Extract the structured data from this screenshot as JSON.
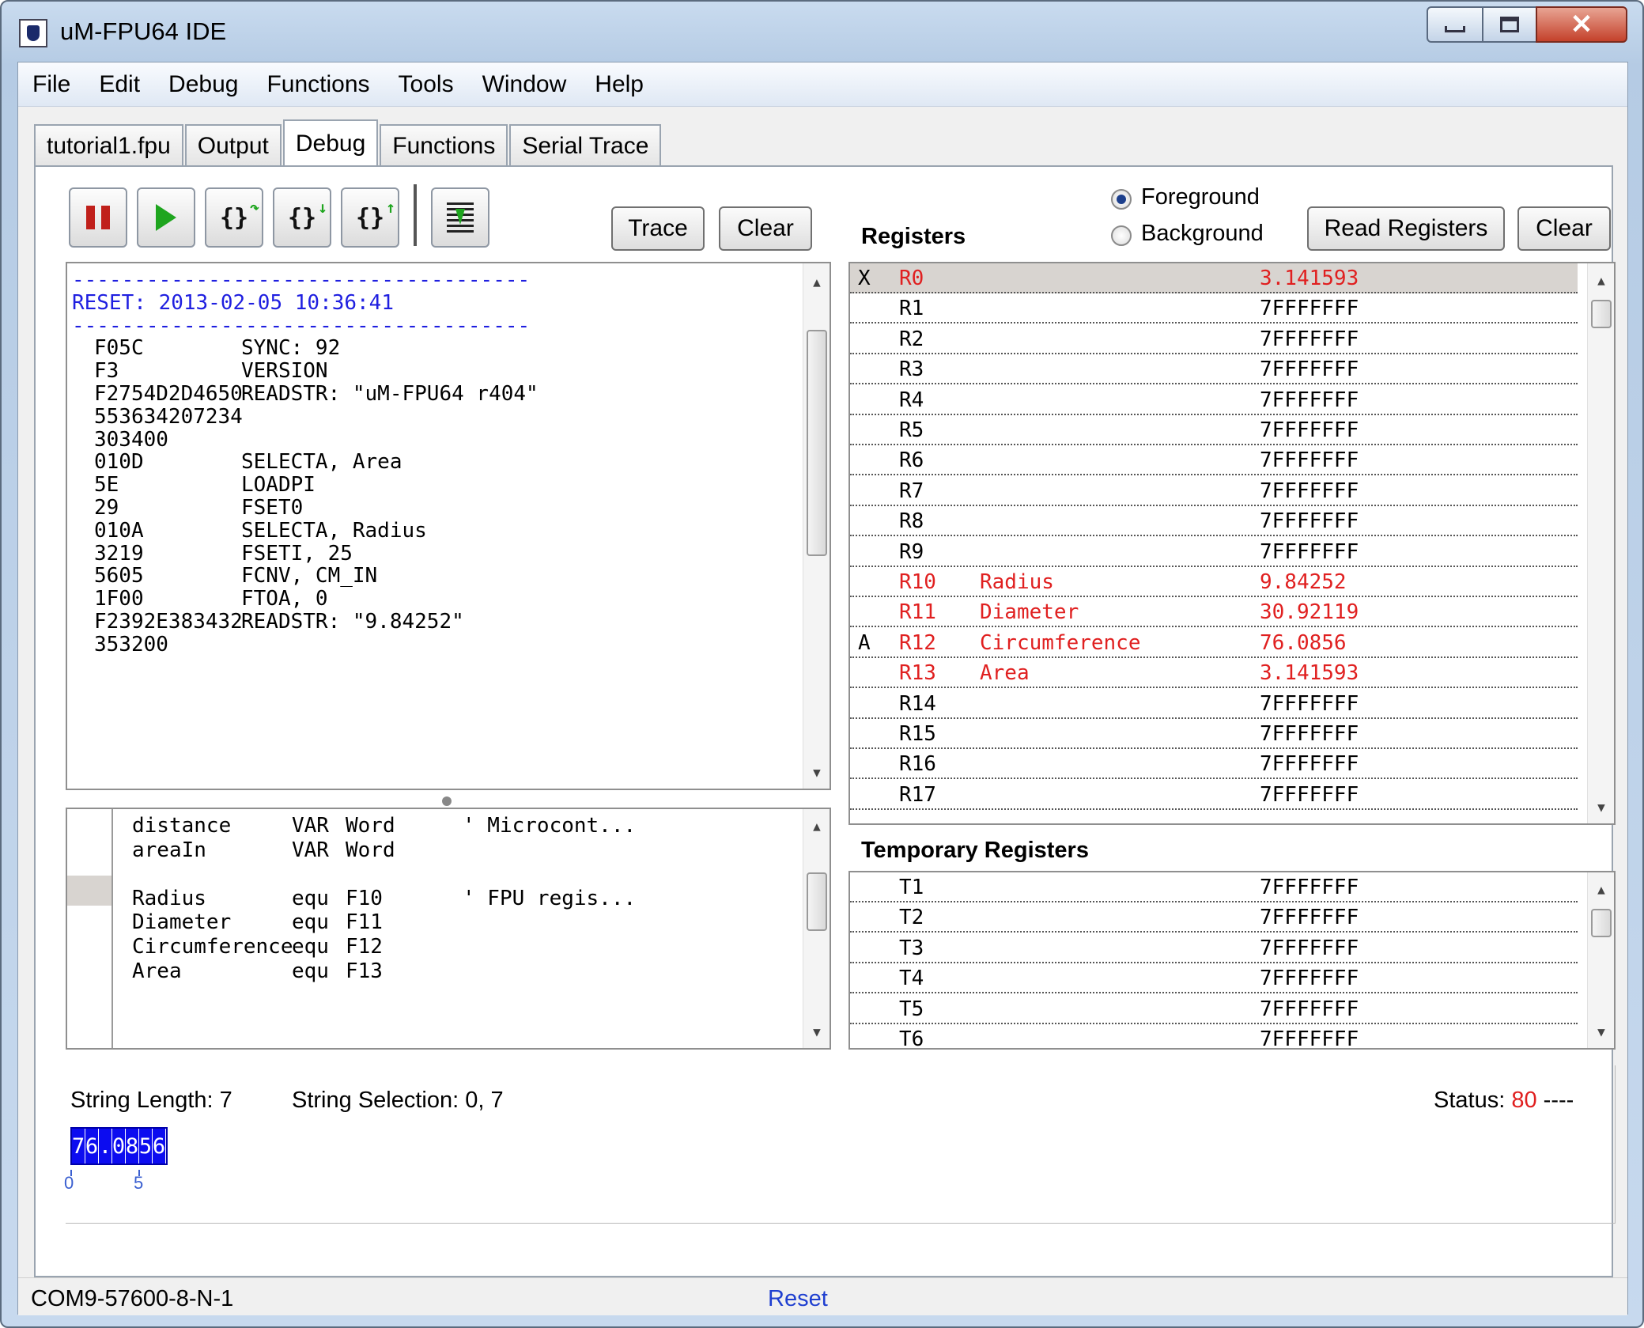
{
  "window": {
    "title": "uM-FPU64 IDE"
  },
  "menu": [
    "File",
    "Edit",
    "Debug",
    "Functions",
    "Tools",
    "Window",
    "Help"
  ],
  "tabs": [
    "tutorial1.fpu",
    "Output",
    "Debug",
    "Functions",
    "Serial Trace"
  ],
  "active_tab": "Debug",
  "toolbar": {
    "icons": [
      "pause-icon",
      "run-icon",
      "step-into-icon",
      "step-over-icon",
      "step-out-icon",
      "trace-lines-icon"
    ],
    "trace_label": "Trace",
    "clear_label": "Clear"
  },
  "trace": {
    "separator": "-------------------------------------",
    "reset_line": "RESET: 2013-02-05 10:36:41",
    "rows": [
      [
        "F05C",
        "SYNC: 92"
      ],
      [
        "F3",
        "VERSION"
      ],
      [
        "F2754D2D4650",
        "READSTR: \"uM-FPU64 r404\""
      ],
      [
        "553634207234",
        ""
      ],
      [
        "303400",
        ""
      ],
      [
        "010D",
        "SELECTA, Area"
      ],
      [
        "5E",
        "LOADPI"
      ],
      [
        "29",
        "FSET0"
      ],
      [
        "010A",
        "SELECTA, Radius"
      ],
      [
        "3219",
        "FSETI, 25"
      ],
      [
        "5605",
        "FCNV, CM_IN"
      ],
      [
        "1F00",
        "FTOA, 0"
      ],
      [
        "F2392E383432",
        "READSTR: \"9.84252\""
      ],
      [
        "353200",
        ""
      ]
    ]
  },
  "source": {
    "lines": [
      [
        "distance",
        "VAR",
        "Word",
        "' Microcont..."
      ],
      [
        "areaIn",
        "VAR",
        "Word",
        ""
      ],
      [
        "",
        "",
        "",
        ""
      ],
      [
        "Radius",
        "equ",
        "F10",
        "' FPU regis..."
      ],
      [
        "Diameter",
        "equ",
        "F11",
        ""
      ],
      [
        "Circumference",
        "equ",
        "F12",
        ""
      ],
      [
        "Area",
        "equ",
        "F13",
        ""
      ]
    ]
  },
  "registers": {
    "title": "Registers",
    "mode_options": [
      "Foreground",
      "Background"
    ],
    "mode_selected": "Foreground",
    "read_label": "Read Registers",
    "clear_label": "Clear",
    "rows": [
      {
        "flag": "X",
        "name": "R0",
        "alias": "",
        "value": "3.141593",
        "changed": true,
        "selected": true
      },
      {
        "flag": "",
        "name": "R1",
        "alias": "",
        "value": "7FFFFFFF",
        "changed": false
      },
      {
        "flag": "",
        "name": "R2",
        "alias": "",
        "value": "7FFFFFFF",
        "changed": false
      },
      {
        "flag": "",
        "name": "R3",
        "alias": "",
        "value": "7FFFFFFF",
        "changed": false
      },
      {
        "flag": "",
        "name": "R4",
        "alias": "",
        "value": "7FFFFFFF",
        "changed": false
      },
      {
        "flag": "",
        "name": "R5",
        "alias": "",
        "value": "7FFFFFFF",
        "changed": false
      },
      {
        "flag": "",
        "name": "R6",
        "alias": "",
        "value": "7FFFFFFF",
        "changed": false
      },
      {
        "flag": "",
        "name": "R7",
        "alias": "",
        "value": "7FFFFFFF",
        "changed": false
      },
      {
        "flag": "",
        "name": "R8",
        "alias": "",
        "value": "7FFFFFFF",
        "changed": false
      },
      {
        "flag": "",
        "name": "R9",
        "alias": "",
        "value": "7FFFFFFF",
        "changed": false
      },
      {
        "flag": "",
        "name": "R10",
        "alias": "Radius",
        "value": "9.84252",
        "changed": true
      },
      {
        "flag": "",
        "name": "R11",
        "alias": "Diameter",
        "value": "30.92119",
        "changed": true
      },
      {
        "flag": "A",
        "name": "R12",
        "alias": "Circumference",
        "value": "76.0856",
        "changed": true
      },
      {
        "flag": "",
        "name": "R13",
        "alias": "Area",
        "value": "3.141593",
        "changed": true
      },
      {
        "flag": "",
        "name": "R14",
        "alias": "",
        "value": "7FFFFFFF",
        "changed": false
      },
      {
        "flag": "",
        "name": "R15",
        "alias": "",
        "value": "7FFFFFFF",
        "changed": false
      },
      {
        "flag": "",
        "name": "R16",
        "alias": "",
        "value": "7FFFFFFF",
        "changed": false
      },
      {
        "flag": "",
        "name": "R17",
        "alias": "",
        "value": "7FFFFFFF",
        "changed": false
      }
    ]
  },
  "temp_registers": {
    "title": "Temporary Registers",
    "rows": [
      {
        "name": "T1",
        "value": "7FFFFFFF"
      },
      {
        "name": "T2",
        "value": "7FFFFFFF"
      },
      {
        "name": "T3",
        "value": "7FFFFFFF"
      },
      {
        "name": "T4",
        "value": "7FFFFFFF"
      },
      {
        "name": "T5",
        "value": "7FFFFFFF"
      },
      {
        "name": "T6",
        "value": "7FFFFFFF"
      }
    ]
  },
  "string_info": {
    "length_label": "String Length: 7",
    "selection_label": "String Selection: 0, 7",
    "status_label": "Status:",
    "status_value": "80",
    "status_suffix": "----",
    "chars": [
      "7",
      "6",
      ".",
      "0",
      "8",
      "5",
      "6"
    ],
    "index_marks": [
      "0",
      "5"
    ]
  },
  "statusbar": {
    "port": "COM9-57600-8-N-1",
    "reset_label": "Reset"
  },
  "colors": {
    "changed": "#e02020",
    "trace_header": "#1f1fe0",
    "string_bg": "#0c0cf0",
    "selected_row": "#d8d4d0"
  }
}
